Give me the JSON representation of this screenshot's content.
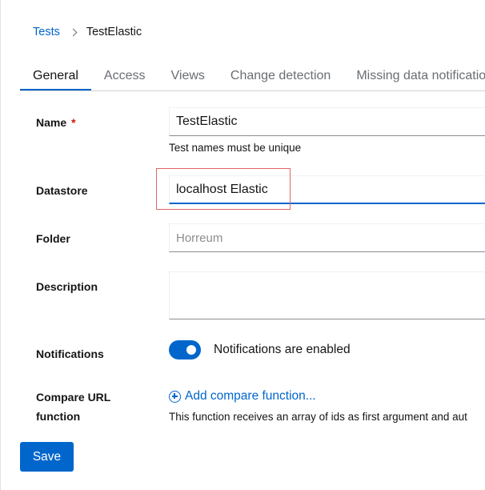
{
  "breadcrumb": {
    "parent": "Tests",
    "current": "TestElastic"
  },
  "tabs": [
    {
      "label": "General"
    },
    {
      "label": "Access"
    },
    {
      "label": "Views"
    },
    {
      "label": "Change detection"
    },
    {
      "label": "Missing data notifications"
    }
  ],
  "active_tab": "General",
  "form": {
    "name": {
      "label": "Name",
      "required_marker": "*",
      "value": "TestElastic",
      "helper": "Test names must be unique"
    },
    "datastore": {
      "label": "Datastore",
      "value": "localhost Elastic"
    },
    "folder": {
      "label": "Folder",
      "placeholder": "Horreum"
    },
    "description": {
      "label": "Description",
      "value": ""
    },
    "notifications": {
      "label": "Notifications",
      "toggle_label": "Notifications are enabled",
      "enabled": true
    },
    "compare_url": {
      "label_line1": "Compare URL",
      "label_line2": "function",
      "add_label": "Add compare function...",
      "helper": "This function receives an array of ids as first argument and aut"
    }
  },
  "actions": {
    "save_label": "Save"
  },
  "colors": {
    "accent": "#0066cc",
    "required": "#c9190b",
    "highlight": "#e06666"
  }
}
